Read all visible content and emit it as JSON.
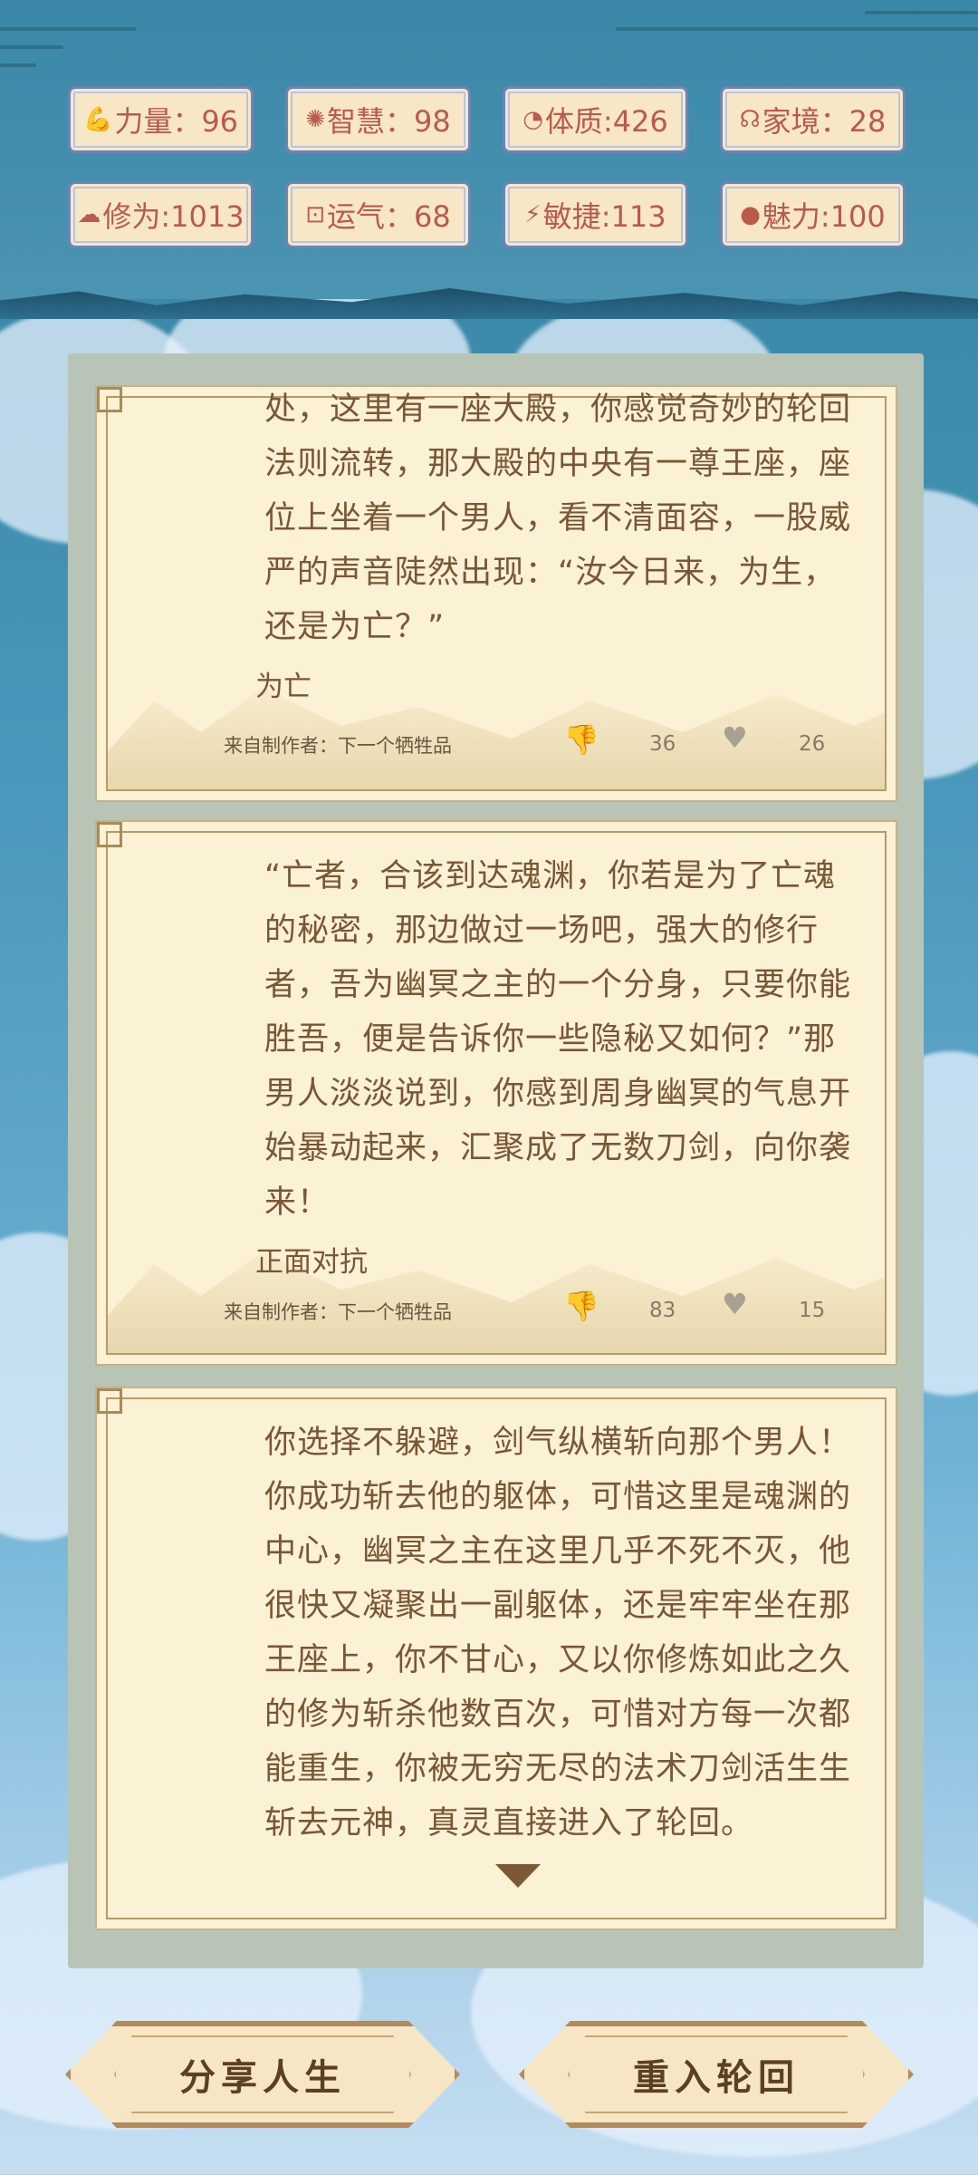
{
  "stats": [
    {
      "icon": "strength-icon",
      "glyph": "💪",
      "label": "力量：96"
    },
    {
      "icon": "wisdom-icon",
      "glyph": "✺",
      "label": "智慧：98"
    },
    {
      "icon": "constitution-icon",
      "glyph": "◔",
      "label": "体质:426"
    },
    {
      "icon": "family-icon",
      "glyph": "☊",
      "label": "家境：28"
    },
    {
      "icon": "cultivation-icon",
      "glyph": "☁",
      "label": "修为:1013"
    },
    {
      "icon": "luck-icon",
      "glyph": "⊡",
      "label": "运气：68"
    },
    {
      "icon": "agility-icon",
      "glyph": "⚡",
      "label": "敏捷:113"
    },
    {
      "icon": "charm-icon",
      "glyph": "●",
      "label": "魅力:100"
    }
  ],
  "cards": [
    {
      "text": "处，这里有一座大殿，你感觉奇妙的轮回法则流转，那大殿的中央有一尊王座，座位上坐着一个男人，看不清面容，一股威严的声音陡然出现：“汝今日来，为生，还是为亡？”",
      "choice": "为亡",
      "author": "来自制作者：下一个牺牲品",
      "dislikes": "36",
      "likes": "26"
    },
    {
      "text": "“亡者，合该到达魂渊，你若是为了亡魂的秘密，那边做过一场吧，强大的修行者，吾为幽冥之主的一个分身，只要你能胜吾，便是告诉你一些隐秘又如何？”那男人淡淡说到，你感到周身幽冥的气息开始暴动起来，汇聚成了无数刀剑，向你袭来！",
      "choice": "正面对抗",
      "author": "来自制作者：下一个牺牲品",
      "dislikes": "83",
      "likes": "15"
    },
    {
      "text": "你选择不躲避，剑气纵横斩向那个男人！你成功斩去他的躯体，可惜这里是魂渊的中心，幽冥之主在这里几乎不死不灭，他很快又凝聚出一副躯体，还是牢牢坐在那王座上，你不甘心，又以你修炼如此之久的修为斩杀他数百次，可惜对方每一次都能重生，你被无穷无尽的法术刀剑活生生斩去元神，真灵直接进入了轮回。"
    }
  ],
  "buttons": {
    "share": "分享人生",
    "restart": "重入轮回"
  }
}
